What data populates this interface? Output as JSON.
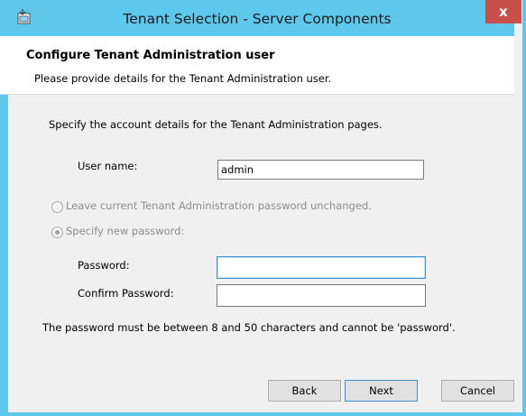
{
  "window": {
    "title": "Tenant Selection - Server Components",
    "close_glyph": "x",
    "icon": "installer-app-icon",
    "accent_color": "#5dc7ec",
    "close_color": "#c7504a"
  },
  "header": {
    "title": "Configure Tenant Administration user",
    "subtitle": "Please provide details for the Tenant Administration user."
  },
  "form": {
    "intro": "Specify the account details for the Tenant Administration pages.",
    "username_label": "User name:",
    "username_value": "admin",
    "radio_unchanged_label": "Leave current Tenant Administration password unchanged.",
    "radio_new_label": "Specify new password:",
    "password_label": "Password:",
    "password_value": "",
    "confirm_label": "Confirm Password:",
    "confirm_value": "",
    "hint": "The password must be between 8 and 50 characters and cannot be 'password'."
  },
  "buttons": {
    "back": "Back",
    "next": "Next",
    "cancel": "Cancel"
  }
}
